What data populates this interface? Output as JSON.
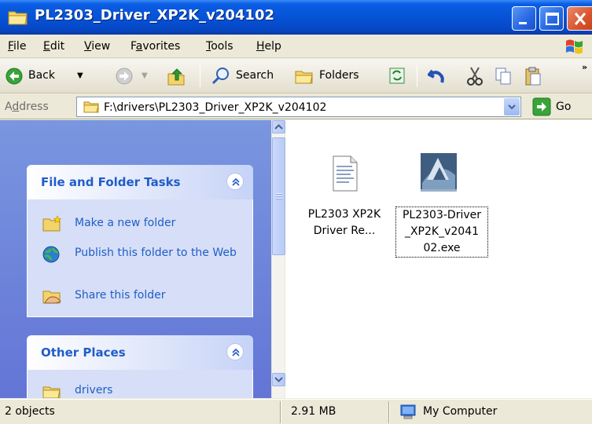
{
  "window": {
    "title": "PL2303_Driver_XP2K_v204102"
  },
  "menu": [
    {
      "label": "File",
      "accel": "F",
      "rest": "ile"
    },
    {
      "label": "Edit",
      "accel": "E",
      "rest": "dit"
    },
    {
      "label": "View",
      "accel": "V",
      "rest": "iew"
    },
    {
      "label": "Favorites",
      "pre": "F",
      "accel": "a",
      "rest": "vorites"
    },
    {
      "label": "Tools",
      "accel": "T",
      "rest": "ools"
    },
    {
      "label": "Help",
      "accel": "H",
      "rest": "elp"
    }
  ],
  "toolbar": {
    "back_label": "Back",
    "search_label": "Search",
    "folders_label": "Folders"
  },
  "address": {
    "label_pre": "A",
    "label_accel": "d",
    "label_rest": "dress",
    "path": "F:\\drivers\\PL2303_Driver_XP2K_v204102",
    "go_label": "Go"
  },
  "tasks_panel": {
    "title": "File and Folder Tasks",
    "items": [
      {
        "label": "Make a new folder",
        "icon": "new-folder-icon"
      },
      {
        "label": "Publish this folder to the Web",
        "icon": "publish-web-icon"
      },
      {
        "label": "Share this folder",
        "icon": "share-folder-icon"
      }
    ]
  },
  "places_panel": {
    "title": "Other Places",
    "items": [
      {
        "label": "drivers",
        "icon": "folder-icon"
      }
    ]
  },
  "files": [
    {
      "name": "PL2303 XP2K Driver Re...",
      "line1": "PL2303 XP2K",
      "line2": "Driver Re...",
      "icon": "text-document-icon",
      "selected": false
    },
    {
      "name": "PL2303-Driver_XP2K_v204102.exe",
      "line1": "PL2303-Driver",
      "line2": "_XP2K_v2041",
      "line3": "02.exe",
      "icon": "installer-exe-icon",
      "selected": true
    }
  ],
  "status": {
    "objects": "2 objects",
    "size": "2.91 MB",
    "location": "My Computer"
  }
}
